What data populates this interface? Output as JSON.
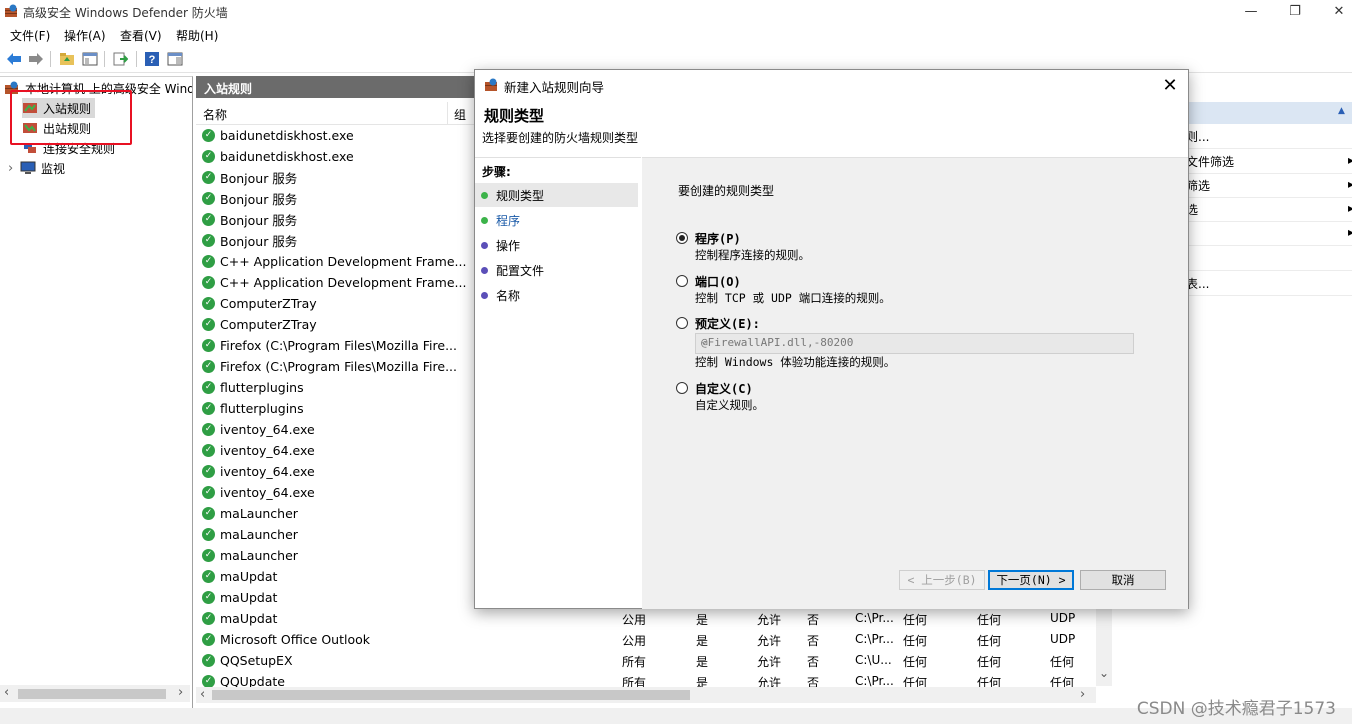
{
  "window": {
    "title": "高级安全 Windows Defender 防火墙",
    "min_glyph": "—",
    "max_glyph": "❐",
    "close_glyph": "✕"
  },
  "menu": {
    "items": [
      {
        "label": "文件(F)"
      },
      {
        "label": "操作(A)"
      },
      {
        "label": "查看(V)"
      },
      {
        "label": "帮助(H)"
      }
    ]
  },
  "toolbar": {
    "icons": [
      "back-arrow-icon",
      "forward-arrow-icon",
      "folder-up-icon",
      "show-hide-tree-icon",
      "export-list-icon",
      "help-icon",
      "show-hide-action-pane-icon"
    ]
  },
  "tree": {
    "root": "本地计算机 上的高级安全 Windows",
    "items": [
      {
        "label": "入站规则",
        "icon": "inbound-rules-icon"
      },
      {
        "label": "出站规则",
        "icon": "outbound-rules-icon"
      },
      {
        "label": "连接安全规则",
        "icon": "connection-security-icon"
      },
      {
        "label": "监视",
        "icon": "monitor-icon"
      }
    ],
    "expand_glyph": "›"
  },
  "middle": {
    "header": "入站规则",
    "columns": {
      "name": "名称",
      "group": "组"
    },
    "rows": [
      {
        "name": "baidunetdiskhost.exe"
      },
      {
        "name": "baidunetdiskhost.exe"
      },
      {
        "name": "Bonjour 服务"
      },
      {
        "name": "Bonjour 服务"
      },
      {
        "name": "Bonjour 服务"
      },
      {
        "name": "Bonjour 服务"
      },
      {
        "name": "C++ Application Development Frame..."
      },
      {
        "name": "C++ Application Development Frame..."
      },
      {
        "name": "ComputerZTray"
      },
      {
        "name": "ComputerZTray"
      },
      {
        "name": "Firefox (C:\\Program Files\\Mozilla Fire..."
      },
      {
        "name": "Firefox (C:\\Program Files\\Mozilla Fire..."
      },
      {
        "name": "flutterplugins"
      },
      {
        "name": "flutterplugins"
      },
      {
        "name": "iventoy_64.exe"
      },
      {
        "name": "iventoy_64.exe"
      },
      {
        "name": "iventoy_64.exe"
      },
      {
        "name": "iventoy_64.exe"
      },
      {
        "name": "maLauncher"
      },
      {
        "name": "maLauncher"
      },
      {
        "name": "maLauncher"
      },
      {
        "name": "maUpdat"
      },
      {
        "name": "maUpdat"
      },
      {
        "name": "maUpdat",
        "profile": "公用",
        "enabled": "是",
        "action": "允许",
        "override": "否",
        "program": "C:\\Pr...",
        "local": "任何",
        "remote": "任何",
        "protocol": "UDP"
      },
      {
        "name": "Microsoft Office Outlook",
        "profile": "公用",
        "enabled": "是",
        "action": "允许",
        "override": "否",
        "program": "C:\\Pr...",
        "local": "任何",
        "remote": "任何",
        "protocol": "UDP"
      },
      {
        "name": "QQSetupEX",
        "profile": "所有",
        "enabled": "是",
        "action": "允许",
        "override": "否",
        "program": "C:\\U...",
        "local": "任何",
        "remote": "任何",
        "protocol": "任何"
      },
      {
        "name": "QQUpdate",
        "profile": "所有",
        "enabled": "是",
        "action": "允许",
        "override": "否",
        "program": "C:\\Pr...",
        "local": "任何",
        "remote": "任何",
        "protocol": "任何"
      }
    ],
    "scroll_down_glyph": "⌄",
    "scroll_left_glyph": "‹",
    "scroll_right_glyph": "›"
  },
  "actions": {
    "items": [
      {
        "label": "则..."
      },
      {
        "label": "文件筛选"
      },
      {
        "label": "筛选"
      },
      {
        "label": "选"
      },
      {
        "label": ""
      },
      {
        "label": ""
      },
      {
        "label": "表..."
      }
    ],
    "collapse_glyph": "▲"
  },
  "dialog": {
    "title": "新建入站规则向导",
    "heading": "规则类型",
    "subheading": "选择要创建的防火墙规则类型",
    "steps_title": "步骤:",
    "steps": [
      {
        "label": "规则类型",
        "color": "#3cb34a"
      },
      {
        "label": "程序",
        "color": "#3cb34a"
      },
      {
        "label": "操作",
        "color": "#5b4fb8"
      },
      {
        "label": "配置文件",
        "color": "#5b4fb8"
      },
      {
        "label": "名称",
        "color": "#5b4fb8"
      }
    ],
    "prompt": "要创建的规则类型",
    "options": [
      {
        "label": "程序(P)",
        "desc": "控制程序连接的规则。",
        "checked": true
      },
      {
        "label": "端口(O)",
        "desc": "控制 TCP 或 UDP 端口连接的规则。",
        "checked": false
      },
      {
        "label": "预定义(E):",
        "desc": "控制 Windows 体验功能连接的规则。",
        "checked": false
      },
      {
        "label": "自定义(C)",
        "desc": "自定义规则。",
        "checked": false
      }
    ],
    "predefined_value": "@FirewallAPI.dll,-80200",
    "select_arrow": "⌄",
    "buttons": {
      "back": "< 上一步(B)",
      "next": "下一页(N) >",
      "cancel": "取消"
    },
    "close_glyph": "✕"
  },
  "watermark": "CSDN @技术瘾君子1573",
  "colors": {
    "accent": "#0078d7",
    "highlight_box": "#e81123",
    "rule_enabled": "#2f9e44"
  }
}
